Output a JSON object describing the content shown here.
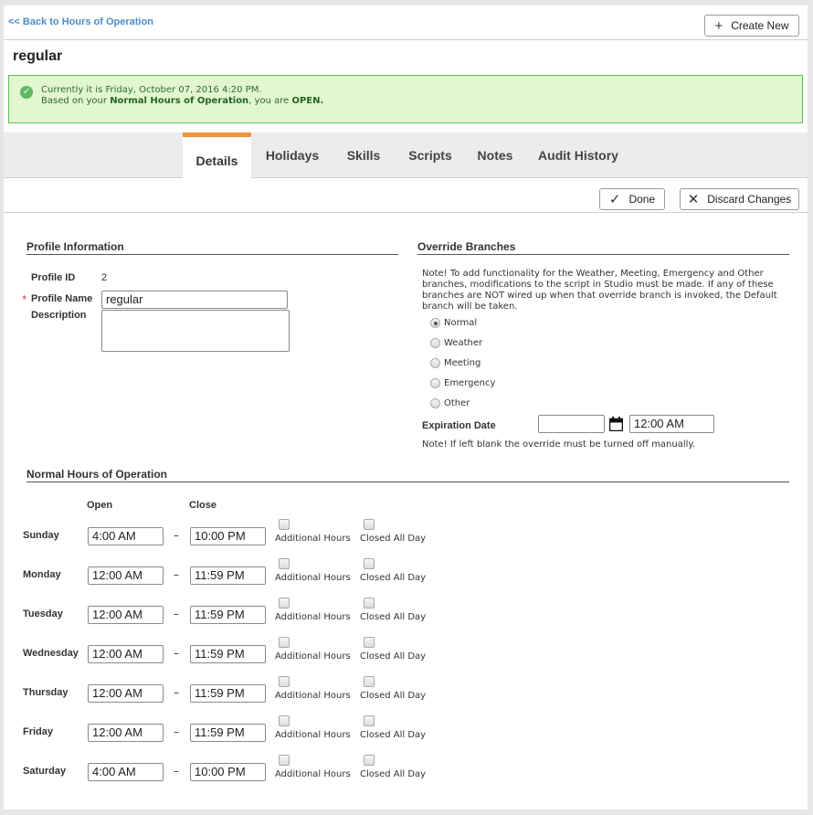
{
  "header": {
    "back_link": "<< Back to Hours of Operation",
    "create_new": "Create New"
  },
  "page_title": "regular",
  "status_alert": {
    "line1": "Currently it is Friday, October 07, 2016 4:20 PM.",
    "line2_prefix": "Based on your ",
    "line2_profile": "Normal Hours of Operation",
    "line2_middle": ", you are ",
    "line2_state": "OPEN."
  },
  "tabs": [
    {
      "label": "Details",
      "active": true
    },
    {
      "label": "Holidays",
      "active": false
    },
    {
      "label": "Skills",
      "active": false
    },
    {
      "label": "Scripts",
      "active": false
    },
    {
      "label": "Notes",
      "active": false
    },
    {
      "label": "Audit History",
      "active": false
    }
  ],
  "actions": {
    "done": "Done",
    "discard": "Discard Changes"
  },
  "profile": {
    "heading": "Profile Information",
    "id_label": "Profile ID",
    "id_value": "2",
    "required_mark": "*",
    "name_label": "Profile Name",
    "name_value": "regular",
    "description_label": "Description",
    "description_value": ""
  },
  "override": {
    "heading": "Override Branches",
    "note": "Note! To add functionality for the Weather, Meeting, Emergency and Other branches, modifications to the script in Studio must be made. If any of these branches are NOT wired up when that override branch is invoked, the Default branch will be taken.",
    "options": [
      "Normal",
      "Weather",
      "Meeting",
      "Emergency",
      "Other"
    ],
    "selected": "Normal",
    "expiration_label": "Expiration Date",
    "expiration_date": "",
    "expiration_time": "12:00 AM",
    "blank_note": "Note! If left blank the override must be turned off manually."
  },
  "hours": {
    "heading": "Normal Hours of Operation",
    "open_header": "Open",
    "close_header": "Close",
    "separator": "–",
    "additional_label": "Additional Hours",
    "closed_label": "Closed All Day",
    "days": [
      {
        "day": "Sunday",
        "open": "4:00 AM",
        "close": "10:00 PM"
      },
      {
        "day": "Monday",
        "open": "12:00 AM",
        "close": "11:59 PM"
      },
      {
        "day": "Tuesday",
        "open": "12:00 AM",
        "close": "11:59 PM"
      },
      {
        "day": "Wednesday",
        "open": "12:00 AM",
        "close": "11:59 PM"
      },
      {
        "day": "Thursday",
        "open": "12:00 AM",
        "close": "11:59 PM"
      },
      {
        "day": "Friday",
        "open": "12:00 AM",
        "close": "11:59 PM"
      },
      {
        "day": "Saturday",
        "open": "4:00 AM",
        "close": "10:00 PM"
      }
    ]
  },
  "icons": {
    "create": "plus-icon",
    "done": "check-icon",
    "discard": "close-icon",
    "alert": "check-circle-icon",
    "calendar": "calendar-icon"
  },
  "colors": {
    "link": "#4a8cc7",
    "tab_accent": "#f0923c",
    "alert_bg": "#e2f6cf",
    "alert_border": "#5cbf5c"
  }
}
